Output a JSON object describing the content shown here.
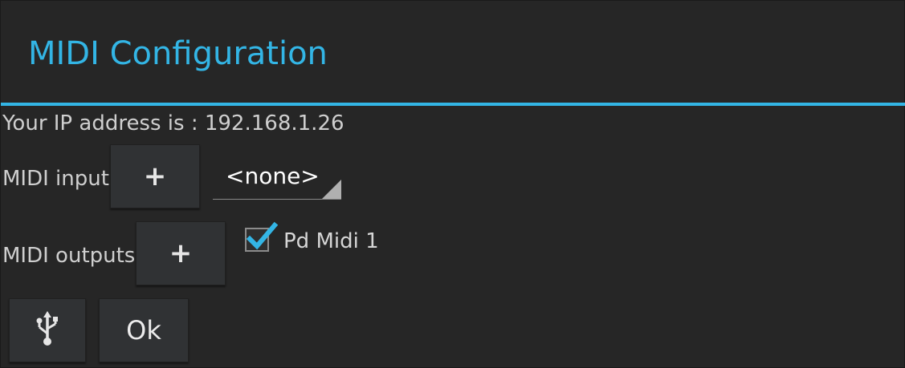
{
  "dialog": {
    "title": "MIDI Configuration",
    "ip_text": "Your IP address is : 192.168.1.26"
  },
  "midi_input": {
    "label": "MIDI input",
    "add_label": "+",
    "selected": "<none>"
  },
  "midi_outputs": {
    "label": "MIDI outputs",
    "add_label": "+",
    "items": [
      {
        "label": "Pd Midi 1",
        "checked": true
      }
    ]
  },
  "actions": {
    "usb_icon": "usb-icon",
    "ok_label": "Ok"
  },
  "colors": {
    "accent": "#33b5e5",
    "background": "#262626",
    "button": "#303234"
  }
}
